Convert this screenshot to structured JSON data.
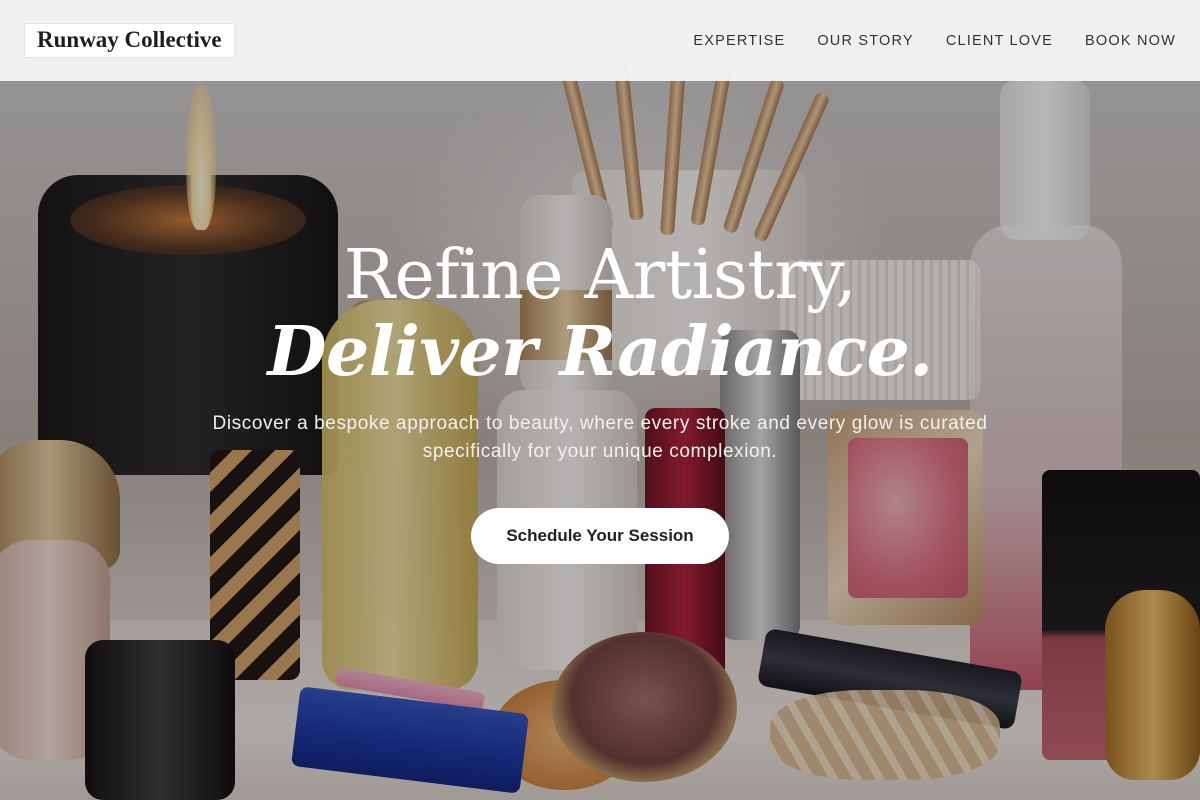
{
  "header": {
    "brand": "Runway Collective",
    "nav": [
      {
        "label": "EXPERTISE"
      },
      {
        "label": "OUR STORY"
      },
      {
        "label": "CLIENT LOVE"
      },
      {
        "label": "BOOK NOW"
      }
    ]
  },
  "hero": {
    "headline_line1": "Refine Artistry,",
    "headline_line2": "Deliver Radiance.",
    "subtitle": "Discover a bespoke approach to beauty, where every stroke and every glow is curated specifically for your unique complexion.",
    "cta_label": "Schedule Your Session",
    "background_image": "makeup-vanity-photo"
  },
  "colors": {
    "nav_background": "#f5f5f6",
    "hero_text": "#ffffff",
    "button_background": "#ffffff",
    "button_text": "#222222"
  }
}
